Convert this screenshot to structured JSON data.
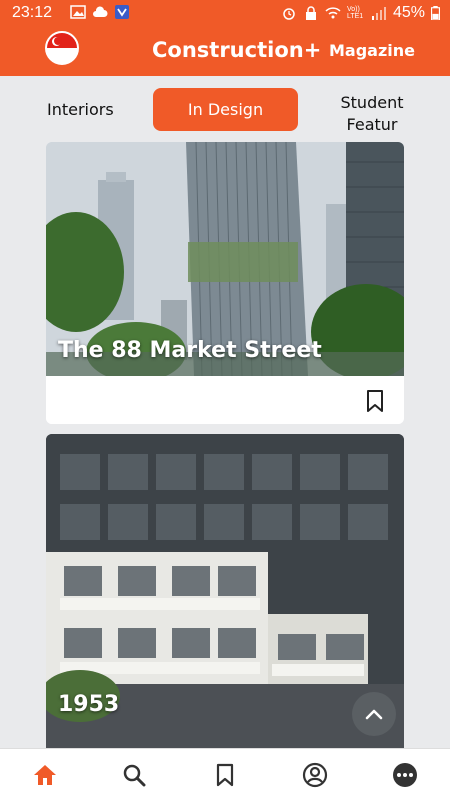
{
  "status_bar": {
    "time": "23:12",
    "network_label": "Vo)) LTE1",
    "battery_percent": "45%"
  },
  "app_bar": {
    "title": "Construction+",
    "magazine_label": "Magazine",
    "flag_icon": "singapore-flag-icon"
  },
  "tabs": [
    {
      "label": "Interiors",
      "selected": false
    },
    {
      "label": "In Design",
      "selected": true
    },
    {
      "label": "Student Featur",
      "selected": false
    }
  ],
  "articles": [
    {
      "title": "The 88 Market Street"
    },
    {
      "title": "1953"
    }
  ],
  "bottom_nav": [
    {
      "name": "home",
      "icon": "home-icon",
      "active": true
    },
    {
      "name": "search",
      "icon": "search-icon",
      "active": false
    },
    {
      "name": "bookmarks",
      "icon": "bookmark-icon",
      "active": false
    },
    {
      "name": "profile",
      "icon": "profile-icon",
      "active": false
    },
    {
      "name": "more",
      "icon": "more-icon",
      "active": false
    }
  ],
  "colors": {
    "brand": "#f05a28",
    "background": "#e9eaec",
    "nav_icon": "#333333"
  }
}
